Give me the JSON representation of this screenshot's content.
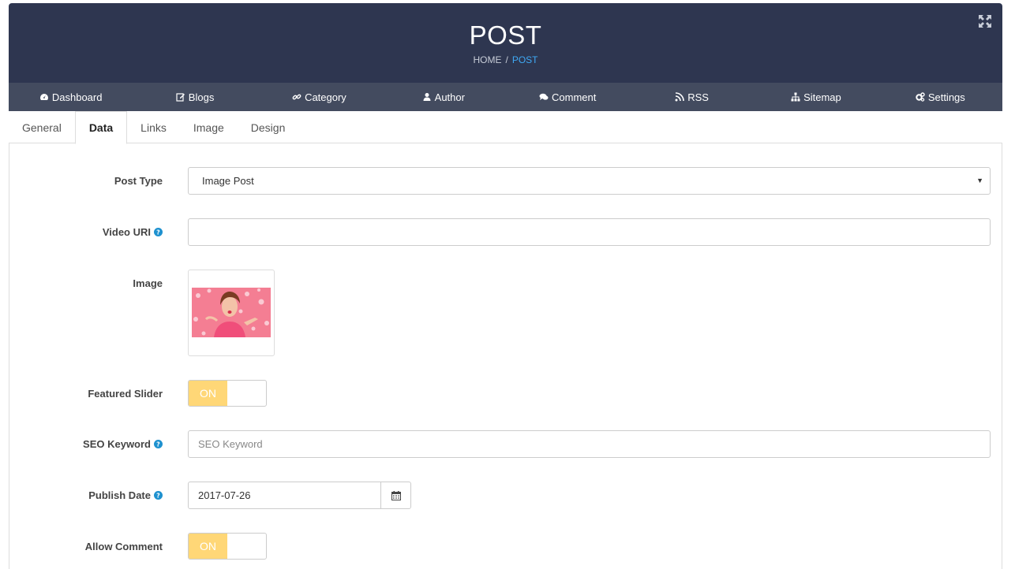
{
  "header": {
    "title": "POST",
    "breadcrumb": {
      "home": "HOME",
      "separator": "/",
      "current": "POST"
    }
  },
  "nav": [
    {
      "label": "Dashboard",
      "icon": "dashboard-icon"
    },
    {
      "label": "Blogs",
      "icon": "edit-icon"
    },
    {
      "label": "Category",
      "icon": "link-icon"
    },
    {
      "label": "Author",
      "icon": "user-icon"
    },
    {
      "label": "Comment",
      "icon": "comments-icon"
    },
    {
      "label": "RSS",
      "icon": "rss-icon"
    },
    {
      "label": "Sitemap",
      "icon": "sitemap-icon"
    },
    {
      "label": "Settings",
      "icon": "cogs-icon"
    }
  ],
  "tabs": [
    {
      "label": "General",
      "active": false
    },
    {
      "label": "Data",
      "active": true
    },
    {
      "label": "Links",
      "active": false
    },
    {
      "label": "Image",
      "active": false
    },
    {
      "label": "Design",
      "active": false
    }
  ],
  "form": {
    "post_type": {
      "label": "Post Type",
      "value": "Image Post"
    },
    "video_uri": {
      "label": "Video URI",
      "value": ""
    },
    "image": {
      "label": "Image"
    },
    "featured_slider": {
      "label": "Featured Slider",
      "state": "ON"
    },
    "seo_keyword": {
      "label": "SEO Keyword",
      "placeholder": "SEO Keyword",
      "value": ""
    },
    "publish_date": {
      "label": "Publish Date",
      "value": "2017-07-26"
    },
    "allow_comment": {
      "label": "Allow Comment",
      "state": "ON"
    }
  },
  "colors": {
    "header_bg": "#2e3650",
    "navbar_bg": "#434b5f",
    "accent": "#3fa9f5",
    "toggle_on": "#ffd777",
    "help_icon": "#1e91cf"
  }
}
